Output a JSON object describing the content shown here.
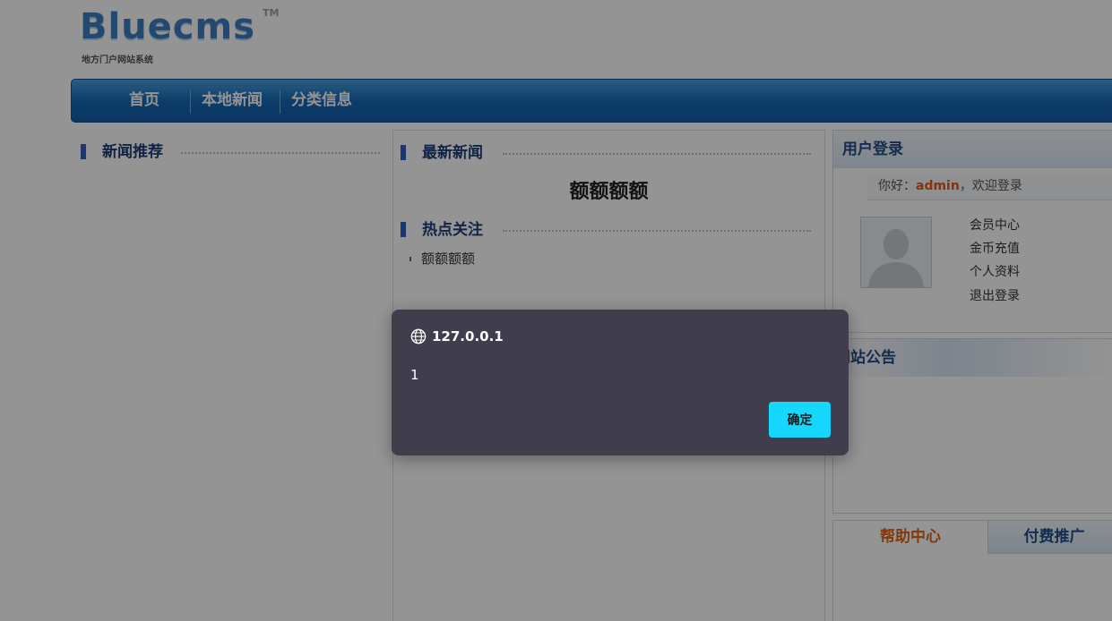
{
  "site": {
    "logo_text": "Bluecms",
    "logo_tm": "TM",
    "logo_subtitle": "地方门户网站系统"
  },
  "nav": {
    "items": [
      {
        "label": "首页"
      },
      {
        "label": "本地新闻"
      },
      {
        "label": "分类信息"
      }
    ]
  },
  "left": {
    "section_title": "新闻推荐"
  },
  "center": {
    "latest_title": "最新新闻",
    "headline": "额额额额",
    "hot_title": "热点关注",
    "hot_items": [
      "额额额额"
    ]
  },
  "right": {
    "login": {
      "title": "用户登录",
      "greeting_prefix": "你好：",
      "username": "admin",
      "greeting_suffix": "，欢迎登录",
      "links": [
        "会员中心",
        "金币充值",
        "个人资料",
        "退出登录"
      ]
    },
    "notice": {
      "title": "网站公告"
    },
    "tabs": [
      {
        "label": "帮助中心",
        "active": true
      },
      {
        "label": "付费推广",
        "active": false
      }
    ]
  },
  "dialog": {
    "origin": "127.0.0.1",
    "message": "1",
    "ok_label": "确定",
    "icon": "globe-icon",
    "button_color": "#16d8ff",
    "background_color": "#403d4c"
  }
}
